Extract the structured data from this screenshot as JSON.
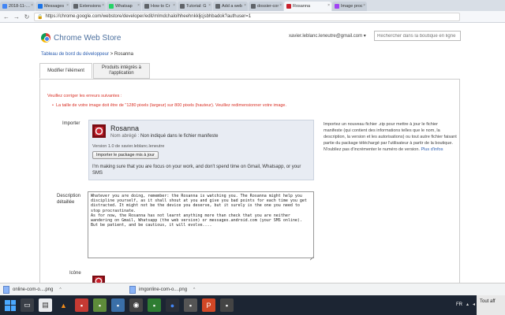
{
  "browser": {
    "tabs": [
      {
        "label": "2018-11-…",
        "color": "#4285f4"
      },
      {
        "label": "Messages",
        "color": "#1a73e8"
      },
      {
        "label": "Extensions",
        "color": "#5f6368"
      },
      {
        "label": "Whatsap",
        "color": "#25d366"
      },
      {
        "label": "How to Cr",
        "color": "#5f6368"
      },
      {
        "label": "Tutorial: G",
        "color": "#5f6368"
      },
      {
        "label": "Add a web",
        "color": "#5f6368"
      },
      {
        "label": "dossier-cor",
        "color": "#5f6368"
      },
      {
        "label": "Rosanna",
        "color": "#c9202c",
        "active": true
      },
      {
        "label": "Image proc",
        "color": "#a142f4"
      }
    ],
    "url": "https://chrome.google.com/webstore/developer/edit/mlmdchalolhheehnkkljcjsbhbadok?authuser=1"
  },
  "store": {
    "title": "Chrome Web Store",
    "account": "xavier.leblanc.leneutre@gmail.com ▾",
    "search_placeholder": "Rechercher dans la boutique en ligne"
  },
  "breadcrumb": {
    "link": "Tableau de bord du développeur",
    "separator": " > ",
    "current": "Rosanna"
  },
  "tabs": {
    "edit": "Modifier l'élément",
    "integrated": "Produits intégrés à l'application"
  },
  "errors": {
    "title": "Veuillez corriger les erreurs suivantes :",
    "items": [
      "La taille de votre image doit être de \"1280 pixels (largeur) sur 800 pixels (hauteur). Veuillez redimensionner votre image."
    ]
  },
  "import": {
    "label": "Importer",
    "name": "Rosanna",
    "short_key": "Nom abrégé :",
    "short_value": "Non indiqué dans le fichier manifeste",
    "version": "Version 1.0 de xavier.leblanc.leneutre",
    "upload_button": "Importer le package mis à jour",
    "note": "I'm making sure that you are focus on your work, and don't spend time on Gmail, Whatsapp, or your SMS"
  },
  "side_help": {
    "text": "Importez un nouveau fichier .zip pour mettre à jour le fichier manifeste (qui contient des informations telles que le nom, la description, la version et les autorisations) ou tout autre fichier faisant partie du package téléchargé par l'utilisateur à partir de la boutique. N'oubliez pas d'incrémenter le numéro de version.",
    "more": "Plus d'infos"
  },
  "description": {
    "label": "Description détaillée",
    "value": "Whatever you are doing, remember: the Rosanna is watching you. The Rosanna might help you discipline yourself, as it shall shout at you and give you bad points for each time you get distracted. It might not be the device you deserve, but it surely is the one you need to stop procrastinate.\nAs for now, the Rosanna has not learnt anything more than check that you are neither wandering on Gmail, Whatsapp (the web version) or messages.android.com (your SMS online).\nBut be patient, and be cautious, it will evolve...."
  },
  "icon_section": {
    "label": "Icône"
  },
  "downloads": [
    {
      "name": "online-com-o....png"
    },
    {
      "name": "imgonline-com-o....png"
    }
  ],
  "taskbar": {
    "lang": "FR",
    "notification": "Tout aff"
  }
}
